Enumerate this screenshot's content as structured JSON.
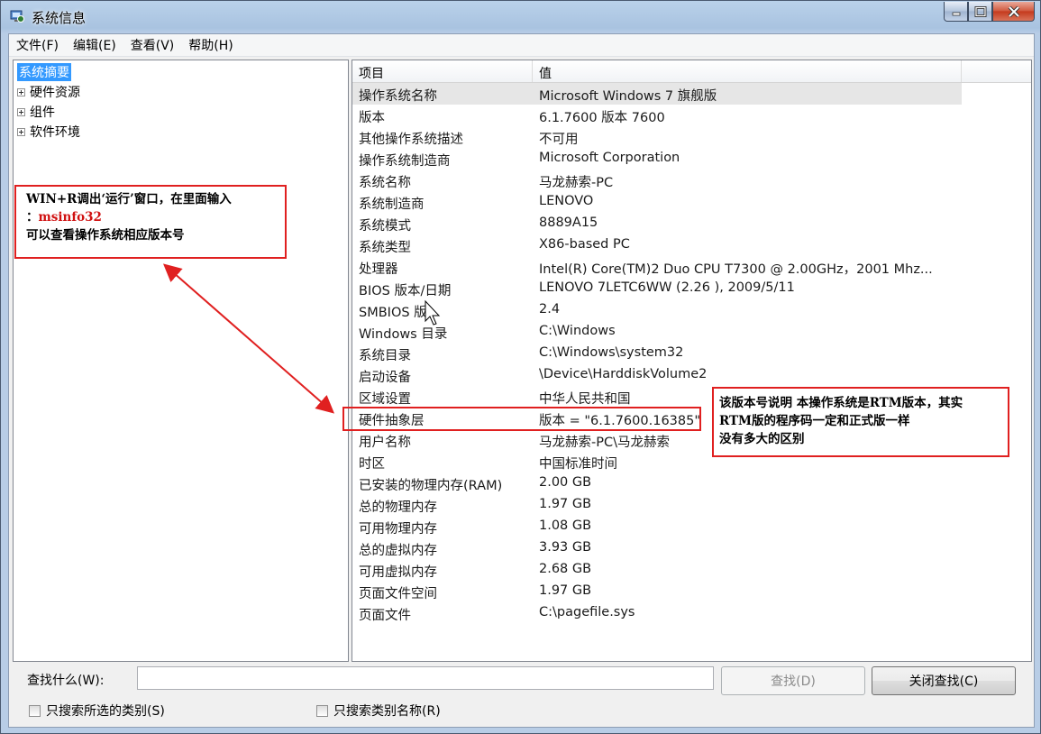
{
  "window": {
    "title": "系统信息"
  },
  "menu": [
    "文件(F)",
    "编辑(E)",
    "查看(V)",
    "帮助(H)"
  ],
  "tree": [
    {
      "label": "系统摘要",
      "selected": true,
      "expandable": false
    },
    {
      "label": "硬件资源",
      "selected": false,
      "expandable": true
    },
    {
      "label": "组件",
      "selected": false,
      "expandable": true
    },
    {
      "label": "软件环境",
      "selected": false,
      "expandable": true
    }
  ],
  "list": {
    "col_item": "项目",
    "col_value": "值",
    "rows": [
      [
        "操作系统名称",
        "Microsoft Windows 7 旗舰版"
      ],
      [
        "版本",
        "6.1.7600 版本 7600"
      ],
      [
        "其他操作系统描述",
        "不可用"
      ],
      [
        "操作系统制造商",
        "Microsoft Corporation"
      ],
      [
        "系统名称",
        "马龙赫索-PC"
      ],
      [
        "系统制造商",
        "LENOVO"
      ],
      [
        "系统模式",
        "8889A15"
      ],
      [
        "系统类型",
        "X86-based PC"
      ],
      [
        "处理器",
        "Intel(R) Core(TM)2 Duo CPU     T7300  @ 2.00GHz，2001 Mhz..."
      ],
      [
        "BIOS 版本/日期",
        "LENOVO 7LETC6WW (2.26 ), 2009/5/11"
      ],
      [
        "SMBIOS 版",
        "2.4"
      ],
      [
        "Windows 目录",
        "C:\\Windows"
      ],
      [
        "系统目录",
        "C:\\Windows\\system32"
      ],
      [
        "启动设备",
        "\\Device\\HarddiskVolume2"
      ],
      [
        "区域设置",
        "中华人民共和国"
      ],
      [
        "硬件抽象层",
        "版本 = \"6.1.7600.16385\""
      ],
      [
        "用户名称",
        "马龙赫索-PC\\马龙赫索"
      ],
      [
        "时区",
        "中国标准时间"
      ],
      [
        "已安装的物理内存(RAM)",
        "2.00 GB"
      ],
      [
        "总的物理内存",
        "1.97 GB"
      ],
      [
        "可用物理内存",
        "1.08 GB"
      ],
      [
        "总的虚拟内存",
        "3.93 GB"
      ],
      [
        "可用虚拟内存",
        "2.68 GB"
      ],
      [
        "页面文件空间",
        "1.97 GB"
      ],
      [
        "页面文件",
        "C:\\pagefile.sys"
      ]
    ]
  },
  "find": {
    "label": "查找什么(W):",
    "value": "",
    "find_button": "查找(D)",
    "close_find_button": "关闭查找(C)",
    "check_selected": "只搜索所选的类别(S)",
    "check_names": "只搜索类别名称(R)"
  },
  "annotations": {
    "left": {
      "line1": "WIN+R调出‘运行’窗口，在里面输入",
      "line2_prefix": "：",
      "line2_cmd": "msinfo32",
      "line3": "可以查看操作系统相应版本号"
    },
    "right": {
      "line1": "该版本号说明 本操作系统是RTM版本，其实",
      "line2": "RTM版的程序码一定和正式版一样",
      "line3": "没有多大的区别"
    }
  },
  "colors": {
    "annotation_red": "#e02020",
    "selection_blue": "#3399ff"
  }
}
